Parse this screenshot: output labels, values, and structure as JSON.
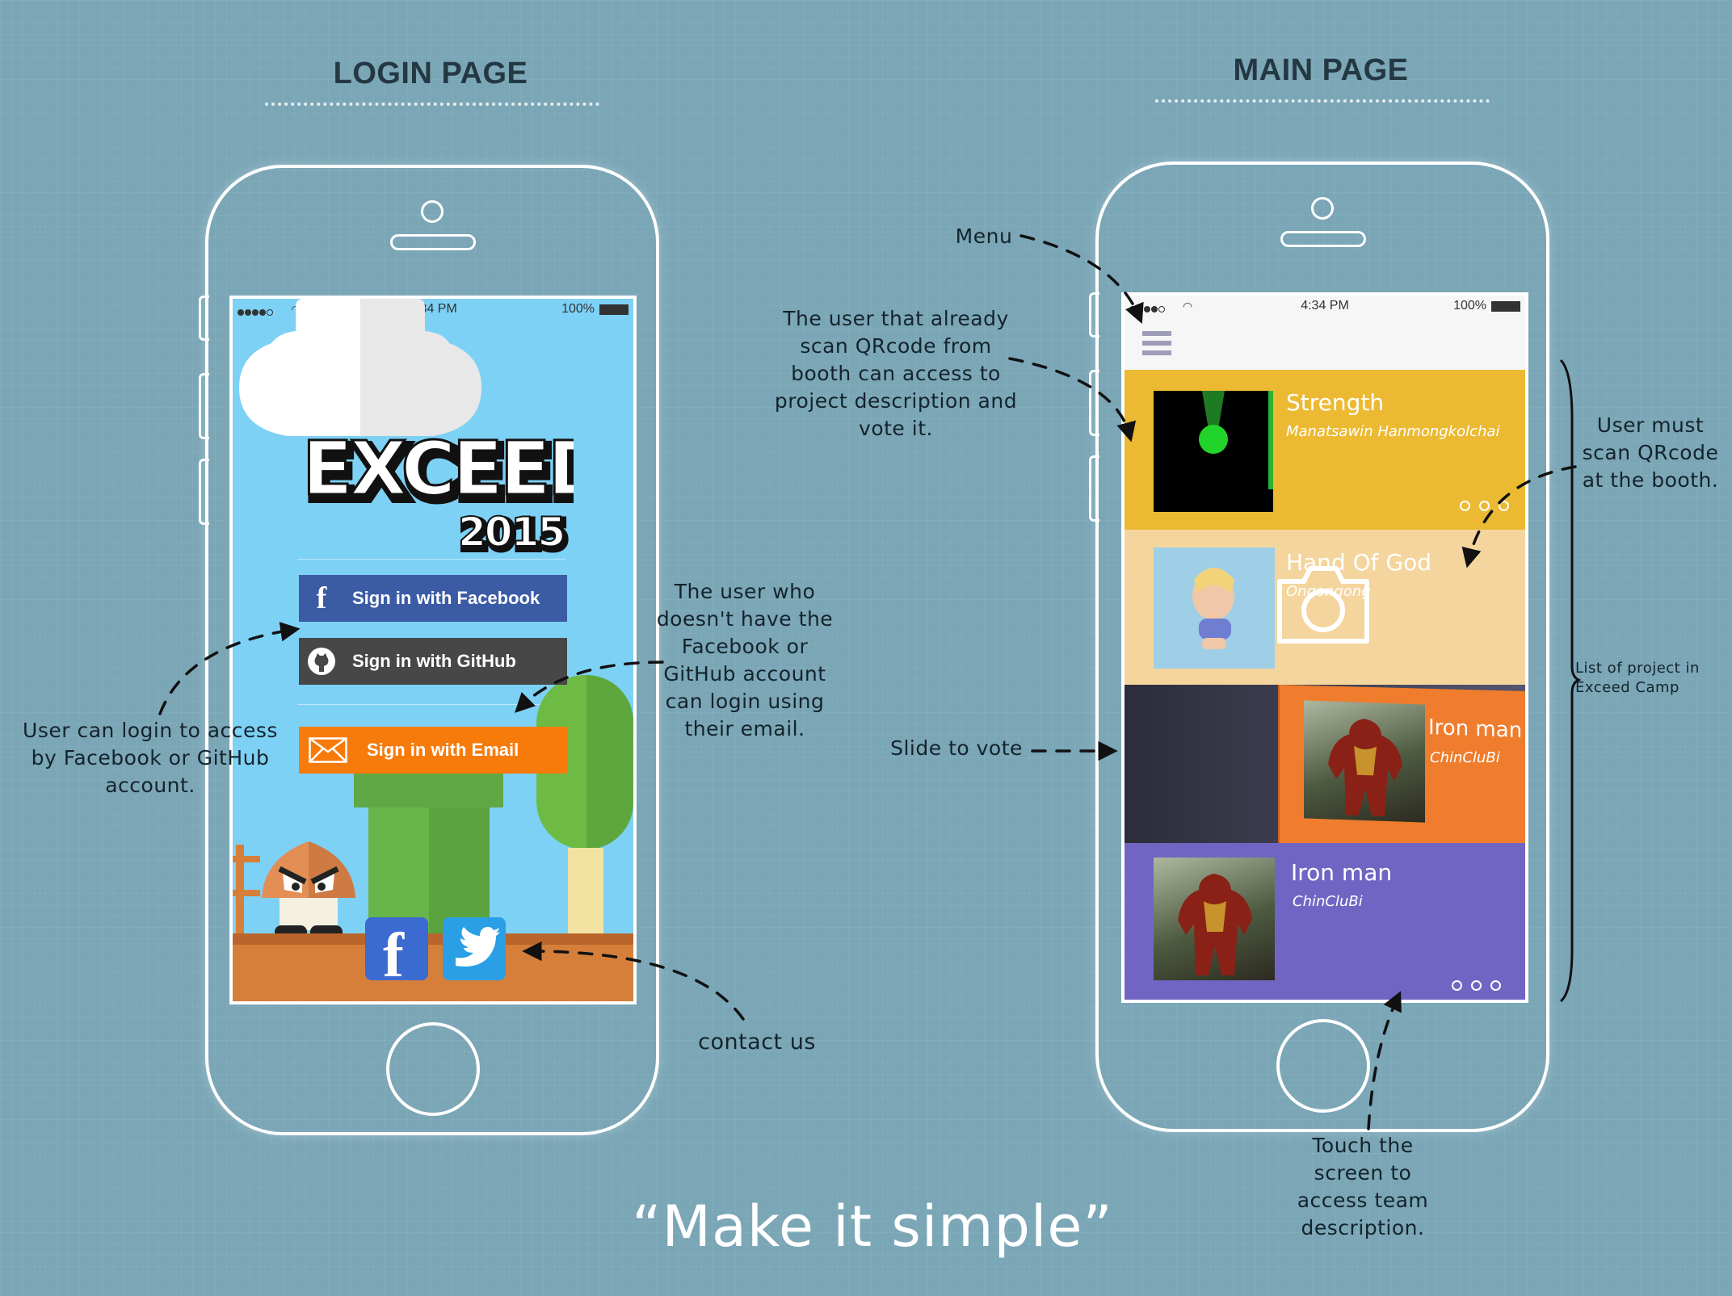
{
  "login": {
    "heading": "LOGIN PAGE",
    "status": {
      "time": "4:34 PM",
      "battery": "100%"
    },
    "logo": {
      "title": "EXCEED",
      "year": "2015"
    },
    "buttons": {
      "facebook": "Sign in with Facebook",
      "github": "Sign in with GitHub",
      "email": "Sign in with Email"
    },
    "colors": {
      "facebook": "#3b5ba5",
      "github": "#474747",
      "email": "#f77b0b",
      "sky": "#7dd1f5",
      "ground": "#d57f3b"
    }
  },
  "main": {
    "heading": "MAIN PAGE",
    "status": {
      "time": "4:34 PM",
      "battery": "100%"
    },
    "cards": [
      {
        "title": "Strength",
        "subtitle": "Manatsawin Hanmongkolchai",
        "color": "#ecba32"
      },
      {
        "title": "Hand Of God",
        "subtitle": "Ongongong",
        "color": "#f4d59d"
      },
      {
        "title": "Iron man",
        "subtitle": "ChinCluBi",
        "color": "#ef7d2d"
      },
      {
        "title": "Iron man",
        "subtitle": "ChinCluBi",
        "color": "#7165c4"
      }
    ]
  },
  "annotations": {
    "login_social": "User can login to access\nby Facebook or GitHub\naccount.",
    "login_email": "The user who\ndoesn't have the\nFacebook or\nGitHub account\ncan login using\ntheir email.",
    "contact": "contact us",
    "menu": "Menu",
    "scanned": "The user that already\nscan QRcode from\nbooth can access to\nproject description and\nvote it.",
    "scan_booth": "User must\nscan QRcode\nat the booth.",
    "list": "List of project in\nExceed Camp",
    "slide": "Slide to vote",
    "touch": "Touch the\nscreen to\naccess team\ndescription."
  },
  "tagline": "“Make it simple”"
}
